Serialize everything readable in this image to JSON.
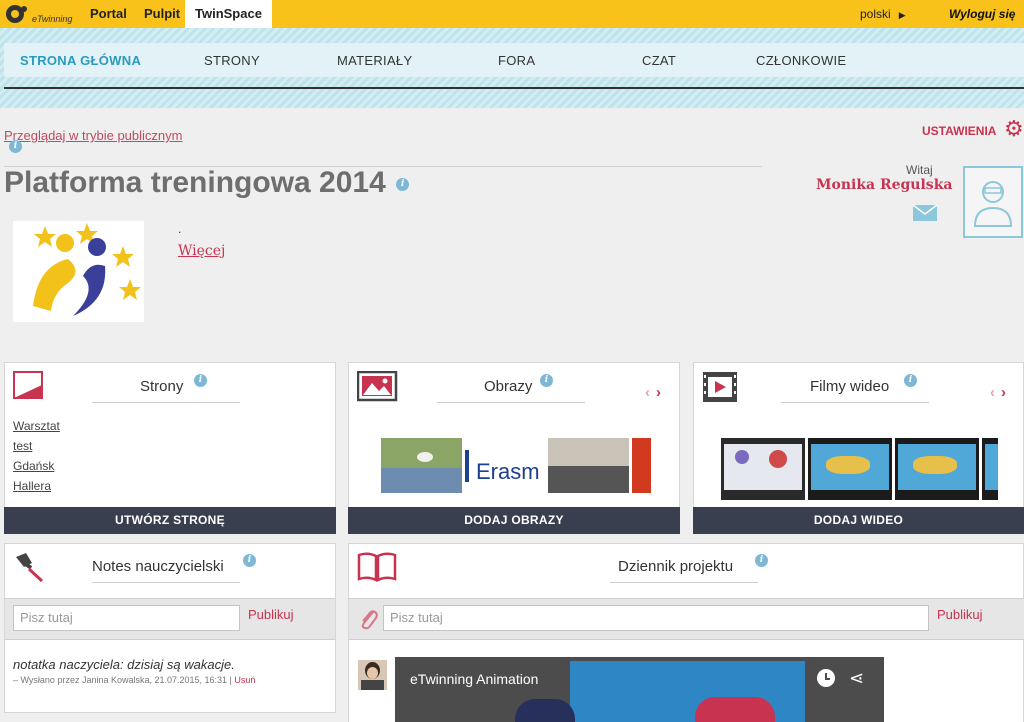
{
  "topbar": {
    "logo_text": "eTwinning",
    "links": [
      "Portal",
      "Pulpit",
      "TwinSpace"
    ],
    "language": "polski",
    "logout": "Wyloguj się"
  },
  "nav": {
    "items": [
      "STRONA GŁÓWNA",
      "STRONY",
      "MATERIAŁY",
      "FORA",
      "CZAT",
      "CZŁONKOWIE"
    ],
    "active_index": 0
  },
  "header": {
    "public_link": "Przeglądaj w trybie publicznym",
    "settings": "USTAWIENIA",
    "title": "Platforma treningowa 2014",
    "welcome": "Witaj",
    "user_name": "Monika Regulska",
    "dot_text": ".",
    "more_link": "Więcej"
  },
  "cards": {
    "pages": {
      "title": "Strony",
      "items": [
        "Warsztat",
        "test",
        "Gdańsk",
        "Hallera"
      ],
      "button": "UTWÓRZ STRONĘ"
    },
    "images": {
      "title": "Obrazy",
      "thumb_text": "Erasm",
      "button": "DODAJ OBRAZY"
    },
    "videos": {
      "title": "Filmy wideo",
      "button": "DODAJ WIDEO"
    },
    "notes": {
      "title": "Notes nauczycielski",
      "placeholder": "Pisz tutaj",
      "publish": "Publikuj",
      "note_text": "notatka naczyciela: dzisiaj są wakacje.",
      "note_meta": "– Wysłano przez Janina Kowalska, 21.07.2015, 16:31 |",
      "note_delete": "Usuń"
    },
    "diary": {
      "title": "Dziennik projektu",
      "placeholder": "Pisz tutaj",
      "publish": "Publikuj",
      "video_title": "eTwinning Animation"
    }
  },
  "info_glyph": "i",
  "colors": {
    "brand_yellow": "#f8c21a",
    "accent_red": "#c8334f",
    "nav_active": "#2a9bc0",
    "button_dark": "#3a3f4f"
  }
}
